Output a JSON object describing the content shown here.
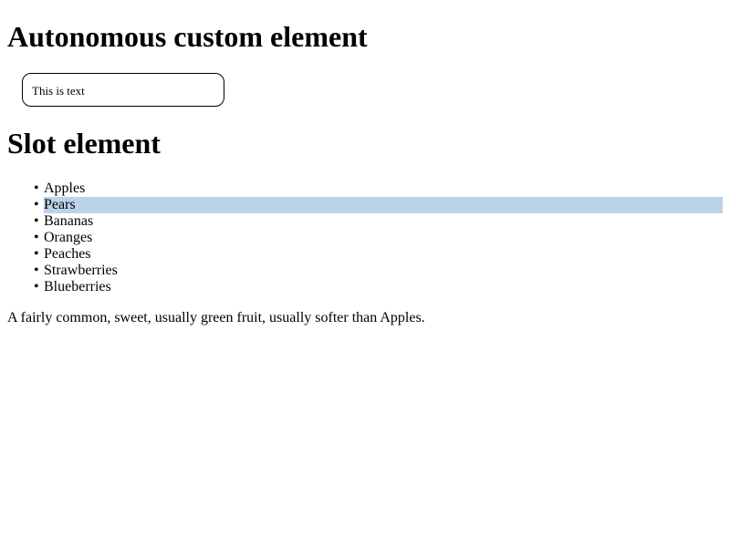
{
  "sections": {
    "custom_heading": "Autonomous custom element",
    "custom_box_text": "This is text",
    "slot_heading": "Slot element"
  },
  "fruits": [
    {
      "bullet": "•",
      "label": "Apples"
    },
    {
      "bullet": "•",
      "label": "Pears"
    },
    {
      "bullet": "•",
      "label": "Bananas"
    },
    {
      "bullet": "•",
      "label": "Oranges"
    },
    {
      "bullet": "•",
      "label": "Peaches"
    },
    {
      "bullet": "•",
      "label": "Strawberries"
    },
    {
      "bullet": "•",
      "label": "Blueberries"
    }
  ],
  "selected_fruit": "Pears",
  "highlight_color": "#bcd2e8",
  "description": "A fairly common, sweet, usually green fruit, usually softer than Apples."
}
